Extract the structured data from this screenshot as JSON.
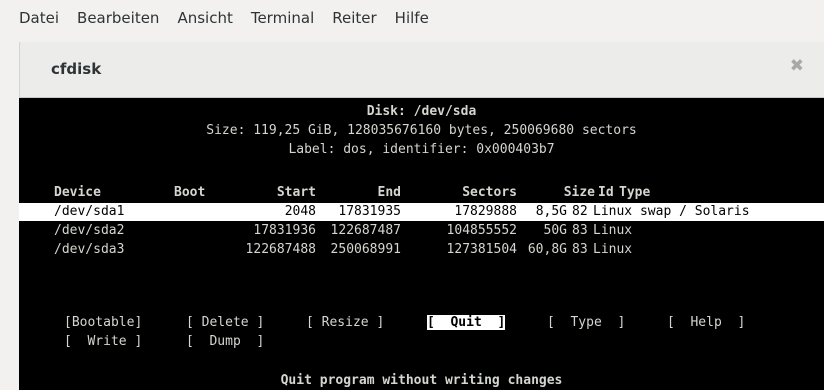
{
  "menu": [
    "Datei",
    "Bearbeiten",
    "Ansicht",
    "Terminal",
    "Reiter",
    "Hilfe"
  ],
  "tab": {
    "title": "cfdisk",
    "close_icon": "✖"
  },
  "disk": {
    "title": "Disk: /dev/sda",
    "size_line": "Size: 119,25 GiB, 128035676160 bytes, 250069680 sectors",
    "label_line": "Label: dos, identifier: 0x000403b7"
  },
  "table": {
    "headers": {
      "device": "Device",
      "boot": "Boot",
      "start": "Start",
      "end": "End",
      "sectors": "Sectors",
      "size": "Size",
      "id": "Id",
      "type": "Type"
    },
    "cursor": ">>",
    "rows": [
      {
        "device": "/dev/sda1",
        "boot": "",
        "start": "2048",
        "end": "17831935",
        "sectors": "17829888",
        "size": "8,5G",
        "id": "82",
        "type": "Linux swap / Solaris",
        "selected": true
      },
      {
        "device": "/dev/sda2",
        "boot": "",
        "start": "17831936",
        "end": "122687487",
        "sectors": "104855552",
        "size": "50G",
        "id": "83",
        "type": "Linux",
        "selected": false
      },
      {
        "device": "/dev/sda3",
        "boot": "",
        "start": "122687488",
        "end": "250068991",
        "sectors": "127381504",
        "size": "60,8G",
        "id": "83",
        "type": "Linux",
        "selected": false
      }
    ]
  },
  "buttons": {
    "bootable": "[Bootable]",
    "delete": "[ Delete ]",
    "resize": "[ Resize ]",
    "quit": "[  Quit  ]",
    "type": "[  Type  ]",
    "help": "[  Help  ]",
    "write": "[  Write ]",
    "dump": "[  Dump  ]"
  },
  "status_text": "Quit program without writing changes"
}
